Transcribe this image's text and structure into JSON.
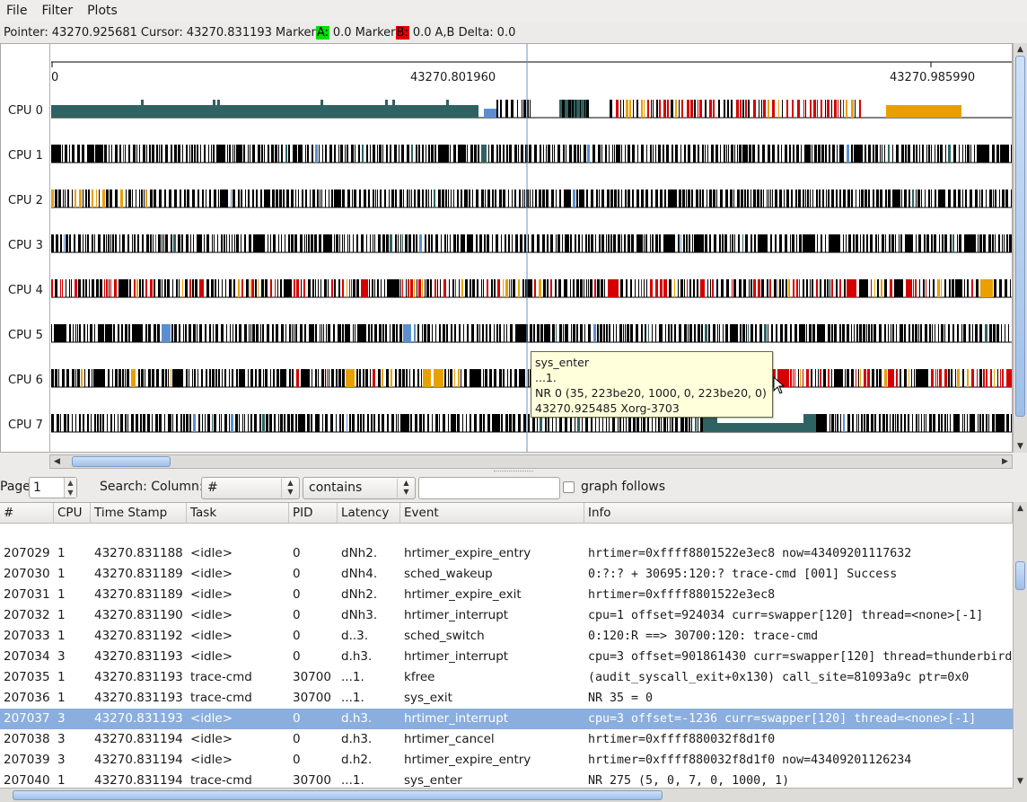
{
  "menu": [
    "File",
    "Filter",
    "Plots"
  ],
  "status": {
    "pointer_label": "Pointer:",
    "pointer_value": "43270.925681",
    "cursor_label": "Cursor:",
    "cursor_value": "43270.831193",
    "marker_a_prefix": "Marker",
    "marker_a_letter": "A:",
    "marker_a_value": "0.0",
    "marker_b_prefix": "Marker",
    "marker_b_letter": "B:",
    "marker_b_value": "0.0",
    "delta_label": "A,B Delta:",
    "delta_value": "0.0"
  },
  "graph": {
    "ticks": [
      "0",
      "43270.801960",
      "43270.985990"
    ],
    "cpus": [
      "CPU 0",
      "CPU 1",
      "CPU 2",
      "CPU 3",
      "CPU 4",
      "CPU 5",
      "CPU 6",
      "CPU 7"
    ],
    "tooltip": [
      "sys_enter",
      "...1.",
      "NR 0 (35, 223be20, 1000, 0, 223be20, 0)",
      "43270.925485 Xorg-3703"
    ],
    "colors": {
      "teal": "#2f6262",
      "black": "#000000",
      "red": "#d40000",
      "orange": "#e8a000",
      "blue": "#5d8fd0",
      "cursor_line": "#6f8fc0"
    }
  },
  "search": {
    "page_label": "Page",
    "page_value": "1",
    "search_label": "Search: Column:",
    "column_value": "#",
    "mode_value": "contains",
    "query_value": "",
    "graph_follows_label": "graph follows"
  },
  "table": {
    "headers": [
      "#",
      "CPU",
      "Time Stamp",
      "Task",
      "PID",
      "Latency",
      "Event",
      "Info"
    ],
    "selected_index": 8,
    "rows": [
      [
        "207029",
        "1",
        "43270.831188",
        "<idle>",
        "0",
        "dNh2.",
        "hrtimer_expire_entry",
        "hrtimer=0xffff8801522e3ec8 now=43409201117632"
      ],
      [
        "207030",
        "1",
        "43270.831189",
        "<idle>",
        "0",
        "dNh4.",
        "sched_wakeup",
        "0:?:? +   30695:120:? trace-cmd [001] Success"
      ],
      [
        "207031",
        "1",
        "43270.831189",
        "<idle>",
        "0",
        "dNh2.",
        "hrtimer_expire_exit",
        "hrtimer=0xffff8801522e3ec8"
      ],
      [
        "207032",
        "1",
        "43270.831190",
        "<idle>",
        "0",
        "dNh3.",
        "hrtimer_interrupt",
        "cpu=1 offset=924034 curr=swapper[120] thread=<none>[-1]"
      ],
      [
        "207033",
        "1",
        "43270.831192",
        "<idle>",
        "0",
        "d..3.",
        "sched_switch",
        "0:120:R ==> 30700:120: trace-cmd"
      ],
      [
        "207034",
        "3",
        "43270.831193",
        "<idle>",
        "0",
        "d.h3.",
        "hrtimer_interrupt",
        "cpu=3 offset=901861430 curr=swapper[120] thread=thunderbird"
      ],
      [
        "207035",
        "1",
        "43270.831193",
        "trace-cmd",
        "30700",
        "...1.",
        "kfree",
        "(audit_syscall_exit+0x130) call_site=81093a9c ptr=0x0"
      ],
      [
        "207036",
        "1",
        "43270.831193",
        "trace-cmd",
        "30700",
        "...1.",
        "sys_exit",
        "NR 35 = 0"
      ],
      [
        "207037",
        "3",
        "43270.831193",
        "<idle>",
        "0",
        "d.h3.",
        "hrtimer_interrupt",
        "cpu=3 offset=-1236 curr=swapper[120] thread=<none>[-1]"
      ],
      [
        "207038",
        "3",
        "43270.831194",
        "<idle>",
        "0",
        "d.h3.",
        "hrtimer_cancel",
        "hrtimer=0xffff880032f8d1f0"
      ],
      [
        "207039",
        "3",
        "43270.831194",
        "<idle>",
        "0",
        "d.h2.",
        "hrtimer_expire_entry",
        "hrtimer=0xffff880032f8d1f0 now=43409201126234"
      ],
      [
        "207040",
        "1",
        "43270.831194",
        "trace-cmd",
        "30700",
        "...1.",
        "sys_enter",
        "NR 275 (5, 0, 7, 0, 1000, 1)"
      ]
    ]
  }
}
